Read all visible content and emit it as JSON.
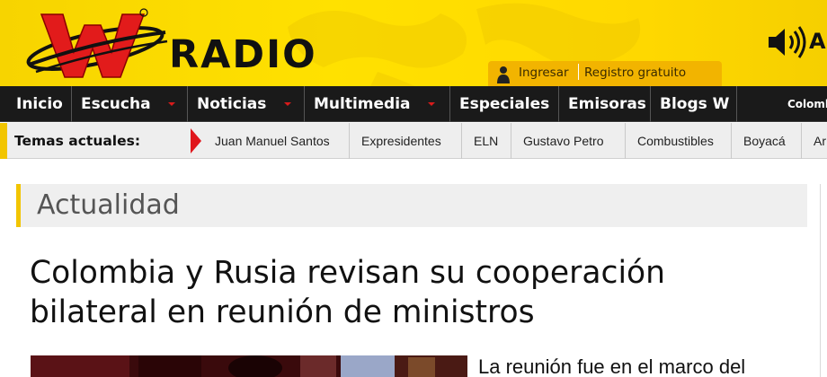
{
  "header": {
    "logo_text": "RADIO",
    "logo_mark": "W",
    "cut_text": "A",
    "login_label": "Ingresar",
    "register_label": "Registro gratuito",
    "icons": [
      "w-logo-icon",
      "speaker-icon",
      "user-icon"
    ],
    "colors": {
      "background": "#ffd900",
      "login_box": "#f2b400"
    }
  },
  "nav": {
    "items": [
      {
        "label": "Inicio",
        "dropdown": false
      },
      {
        "label": "Escucha",
        "dropdown": true
      },
      {
        "label": "Noticias",
        "dropdown": true
      },
      {
        "label": "Multimedia",
        "dropdown": true
      },
      {
        "label": "Especiales",
        "dropdown": false
      },
      {
        "label": "Emisoras",
        "dropdown": false
      },
      {
        "label": "Blogs W",
        "dropdown": false
      }
    ],
    "right_text": "Colombia"
  },
  "topics": {
    "label": "Temas actuales:",
    "items": [
      "Juan Manuel Santos",
      "Expresidentes",
      "ELN",
      "Gustavo Petro",
      "Combustibles",
      "Boyacá",
      "Ar"
    ]
  },
  "article": {
    "section": "Actualidad",
    "headline_line1": "Colombia y Rusia revisan su cooperación",
    "headline_line2": "bilateral en reunión de ministros",
    "lead": "La reunión fue en el marco del"
  }
}
